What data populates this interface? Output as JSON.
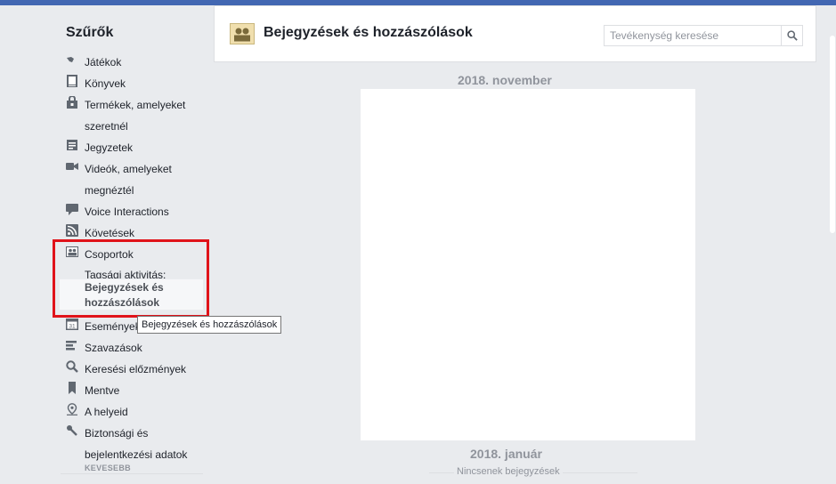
{
  "sidebar": {
    "title": "Szűrők",
    "items": [
      {
        "label": "Játékok",
        "icon": "game-controller-icon"
      },
      {
        "label": "Könyvek",
        "icon": "book-icon"
      },
      {
        "label": "Termékek, amelyeket",
        "label2": "szeretnél",
        "icon": "shopping-bag-icon"
      },
      {
        "label": "Jegyzetek",
        "icon": "note-icon"
      },
      {
        "label": "Videók, amelyeket",
        "label2": "megnéztél",
        "icon": "video-camera-icon"
      },
      {
        "label": "Voice Interactions",
        "icon": "speech-bubble-icon"
      },
      {
        "label": "Követések",
        "icon": "rss-feed-icon"
      },
      {
        "label": "Csoportok",
        "icon": "group-icon"
      },
      {
        "label": "Események",
        "icon": "calendar-icon"
      },
      {
        "label": "Szavazások",
        "icon": "poll-icon"
      },
      {
        "label": "Keresési előzmények",
        "icon": "search-icon"
      },
      {
        "label": "Mentve",
        "icon": "bookmark-icon"
      },
      {
        "label": "A helyeid",
        "icon": "location-pin-icon"
      },
      {
        "label": "Biztonsági és",
        "label2": "bejelentkezési adatok",
        "icon": "key-icon"
      }
    ],
    "group_sub_heading": "Tagsági aktivitás:",
    "group_sub_selected_line1": "Bejegyzések és",
    "group_sub_selected_line2": "hozzászólások",
    "calendar_number": "31",
    "less_label": "KEVESEBB"
  },
  "tooltip": "Bejegyzések és hozzászólások",
  "header": {
    "title": "Bejegyzések és hozzászólások",
    "search_placeholder": "Tevékenység keresése"
  },
  "timeline": {
    "month1": "2018. november",
    "month2": "2018. január",
    "no_posts": "Nincsenek bejegyzések"
  },
  "colors": {
    "brand_bar": "#4267b2",
    "highlight_border": "#e0131a",
    "background": "#e9ebee"
  }
}
